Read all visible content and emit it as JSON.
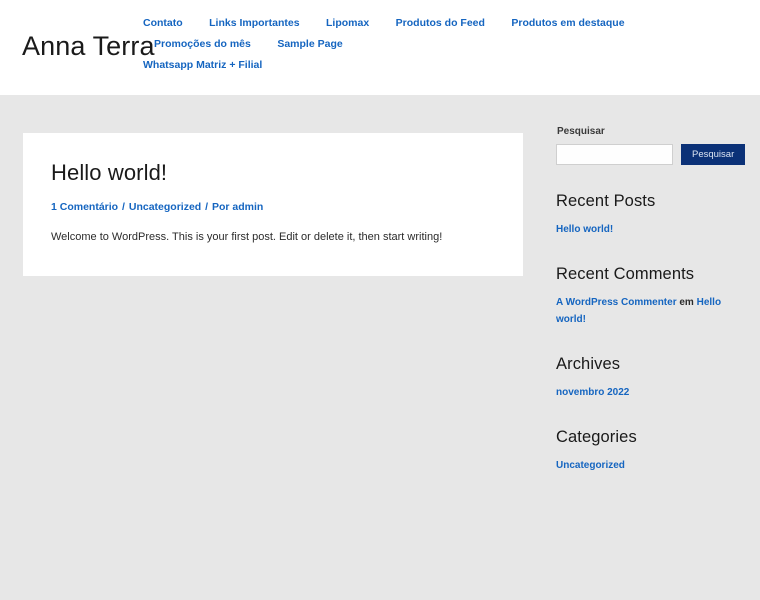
{
  "site": {
    "title": "Anna Terra"
  },
  "nav": {
    "primary_items": [
      {
        "label": "Contato",
        "name": "nav-item-contato"
      },
      {
        "label": "Links Importantes",
        "name": "nav-item-links-importantes"
      },
      {
        "label": "Lipomax",
        "name": "nav-item-lipomax"
      },
      {
        "label": "Produtos do Feed",
        "name": "nav-item-produtos-do-feed"
      },
      {
        "label": "Produtos em destaque",
        "name": "nav-item-produtos-em-destaque"
      },
      {
        "label": "Promoções do mês",
        "name": "nav-item-promocoes-do-mes"
      },
      {
        "label": "Sample Page",
        "name": "nav-item-sample-page"
      }
    ],
    "secondary_items": [
      {
        "label": "Whatsapp Matriz + Filial",
        "name": "nav-item-whatsapp-matriz-filial"
      }
    ]
  },
  "post": {
    "title": "Hello world!",
    "meta": {
      "comments": "1 Comentário",
      "separator_1": "/",
      "category": "Uncategorized",
      "separator_2": "/",
      "author": "Por admin"
    },
    "excerpt": "Welcome to WordPress. This is your first post. Edit or delete it, then start writing!"
  },
  "sidebar": {
    "search": {
      "label": "Pesquisar",
      "input_value": "",
      "placeholder": "",
      "button_label": "Pesquisar"
    },
    "recent_posts": {
      "title": "Recent Posts",
      "items": [
        {
          "label": "Hello world!"
        }
      ]
    },
    "recent_comments": {
      "title": "Recent Comments",
      "items": [
        {
          "author": "A WordPress Commenter",
          "connector": "em",
          "post": "Hello world!"
        }
      ]
    },
    "archives": {
      "title": "Archives",
      "items": [
        {
          "label": "novembro 2022"
        }
      ]
    },
    "categories": {
      "title": "Categories",
      "items": [
        {
          "label": "Uncategorized"
        }
      ]
    }
  },
  "colors": {
    "link_blue": "#1565c0",
    "button_navy": "#0b3177",
    "page_background": "#e7e7e7",
    "card_background": "#ffffff",
    "text_dark": "#1a1a1a"
  }
}
